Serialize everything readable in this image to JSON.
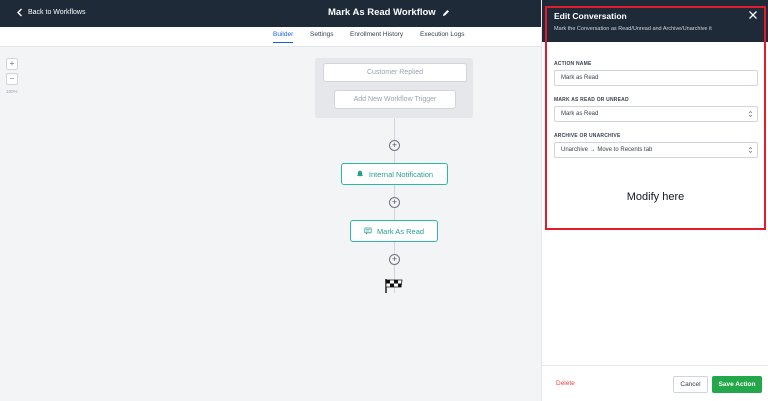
{
  "topbar": {
    "back_label": "Back to Workflows",
    "title": "Mark As Read Workflow"
  },
  "tabs": [
    {
      "label": "Builder",
      "active": true
    },
    {
      "label": "Settings",
      "active": false
    },
    {
      "label": "Enrollment History",
      "active": false
    },
    {
      "label": "Execution Logs",
      "active": false
    }
  ],
  "canvas": {
    "zoom_in": "+",
    "zoom_out": "−",
    "zoom_level": "100%",
    "triggers": [
      "Customer Replied",
      "Add New Workflow Trigger"
    ],
    "actions": [
      "Internal Notification",
      "Mark As Read"
    ]
  },
  "panel": {
    "title": "Edit Conversation",
    "subtitle": "Mark the Conversation as Read/Unread and Archive/Unarchive it",
    "fields": [
      {
        "label": "ACTION NAME",
        "value": "Mark as Read"
      },
      {
        "label": "MARK AS READ OR UNREAD",
        "value": "Mark as Read"
      },
      {
        "label": "ARCHIVE OR UNARCHIVE",
        "value": "Unarchive → Move to Recents tab"
      }
    ],
    "annotation": "Modify here",
    "delete_label": "Delete",
    "cancel_label": "Cancel",
    "save_label": "Save Action"
  },
  "colors": {
    "header_bg": "#1e2a38",
    "accent_blue": "#155eef",
    "node_teal": "#2bb8a4",
    "save_green": "#22a84a",
    "highlight_red": "#e11d2c",
    "delete_red": "#ef4444"
  }
}
